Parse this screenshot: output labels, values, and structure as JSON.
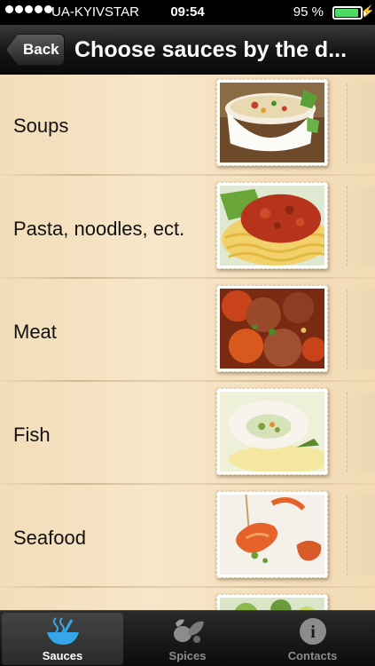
{
  "status_bar": {
    "carrier": "UA-KYIVSTAR",
    "time": "09:54",
    "battery_percent": "95 %",
    "battery_level": 0.95,
    "icons": [
      "signal-dots-icon",
      "battery-icon",
      "charging-bolt-icon"
    ]
  },
  "navbar": {
    "back_label": "Back",
    "title": "Choose sauces by the d..."
  },
  "list": {
    "items": [
      {
        "label": "Soups",
        "icon": "soup-bowl-photo"
      },
      {
        "label": "Pasta, noodles, ect.",
        "icon": "pasta-photo"
      },
      {
        "label": "Meat",
        "icon": "meat-stew-photo"
      },
      {
        "label": "Fish",
        "icon": "fish-roll-photo"
      },
      {
        "label": "Seafood",
        "icon": "shrimp-photo"
      },
      {
        "label": "",
        "icon": "salad-photo"
      }
    ]
  },
  "tabbar": {
    "tabs": [
      {
        "label": "Sauces",
        "icon": "sauce-bowl-icon",
        "active": true
      },
      {
        "label": "Spices",
        "icon": "spices-icon",
        "active": false
      },
      {
        "label": "Contacts",
        "icon": "contacts-info-icon",
        "active": false
      }
    ]
  },
  "colors": {
    "list_background": "#f5e2c2",
    "active_tab_icon": "#35a7e8",
    "battery_fill": "#4cd964"
  }
}
